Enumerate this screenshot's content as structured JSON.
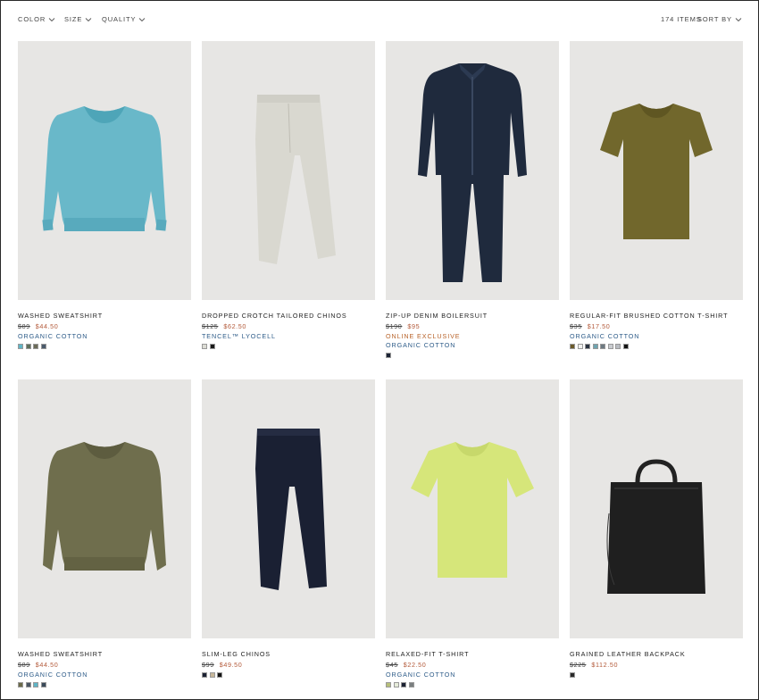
{
  "filters": {
    "color_label": "COLOR",
    "size_label": "SIZE",
    "quality_label": "QUALITY",
    "items_count": "174 ITEMS",
    "sort_label": "SORT BY"
  },
  "colors": {
    "label_blue": "#2d5b88",
    "online_orange": "#b8632a",
    "sale_red": "#b35a3a"
  },
  "products": [
    {
      "name": "WASHED SWEATSHIRT",
      "old_price": "$89",
      "price": "$44.50",
      "tag1": "ORGANIC COTTON",
      "tag2": "",
      "swatches": [
        "#5fb5c6",
        "#5e6e5a",
        "#6b6b58",
        "#4b5a6b"
      ],
      "icon": "sweatshirt-blue"
    },
    {
      "name": "DROPPED CROTCH TAILORED CHINOS",
      "old_price": "$125",
      "price": "$62.50",
      "tag1": "TENCEL™ LYOCELL",
      "tag2": "",
      "swatches": [
        "#dcdcd4",
        "#1a1a1a"
      ],
      "icon": "chinos-white"
    },
    {
      "name": "ZIP-UP DENIM BOILERSUIT",
      "old_price": "$190",
      "price": "$95",
      "tag1": "ONLINE EXCLUSIVE",
      "tag2": "ORGANIC COTTON",
      "swatches": [
        "#1c2435"
      ],
      "icon": "boilersuit"
    },
    {
      "name": "REGULAR-FIT BRUSHED COTTON T-SHIRT",
      "old_price": "$35",
      "price": "$17.50",
      "tag1": "ORGANIC COTTON",
      "tag2": "",
      "swatches": [
        "#6b5a2b",
        "#f2f2f0",
        "#2a3340",
        "#6fa4b0",
        "#6e7a82",
        "#c9ccd0",
        "#b9bdc2",
        "#141414"
      ],
      "icon": "tshirt-olive"
    },
    {
      "name": "WASHED SWEATSHIRT",
      "old_price": "$89",
      "price": "$44.50",
      "tag1": "ORGANIC COTTON",
      "tag2": "",
      "swatches": [
        "#6b6a48",
        "#4a5563",
        "#5fb5c6",
        "#3a4a5a"
      ],
      "icon": "sweatshirt-olive"
    },
    {
      "name": "SLIM-LEG CHINOS",
      "old_price": "$99",
      "price": "$49.50",
      "tag1": "",
      "tag2": "",
      "swatches": [
        "#1c2233",
        "#c8b79a",
        "#141414"
      ],
      "icon": "chinos-navy"
    },
    {
      "name": "RELAXED-FIT T-SHIRT",
      "old_price": "$45",
      "price": "$22.50",
      "tag1": "ORGANIC COTTON",
      "tag2": "",
      "swatches": [
        "#b7bf7a",
        "#e6ecda",
        "#1c2233",
        "#7a7f80"
      ],
      "icon": "tshirt-lime"
    },
    {
      "name": "GRAINED LEATHER BACKPACK",
      "old_price": "$225",
      "price": "$112.50",
      "tag1": "",
      "tag2": "",
      "swatches": [
        "#2a2a2a"
      ],
      "icon": "backpack-black"
    }
  ]
}
